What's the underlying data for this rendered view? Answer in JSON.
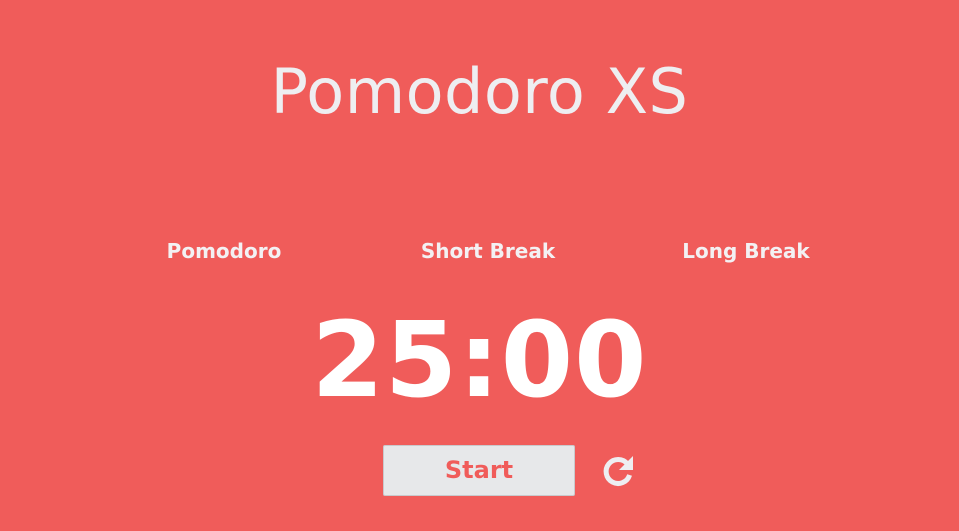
{
  "app": {
    "title": "Pomodoro XS"
  },
  "modes": {
    "pomodoro_label": "Pomodoro",
    "short_break_label": "Short Break",
    "long_break_label": "Long Break"
  },
  "timer": {
    "display": "25:00"
  },
  "controls": {
    "start_label": "Start",
    "reset_icon": "reset-icon"
  },
  "colors": {
    "background": "#f05c5a",
    "text": "#eeeef1",
    "button_bg": "#e7e8ea",
    "button_text": "#f05c5a"
  }
}
